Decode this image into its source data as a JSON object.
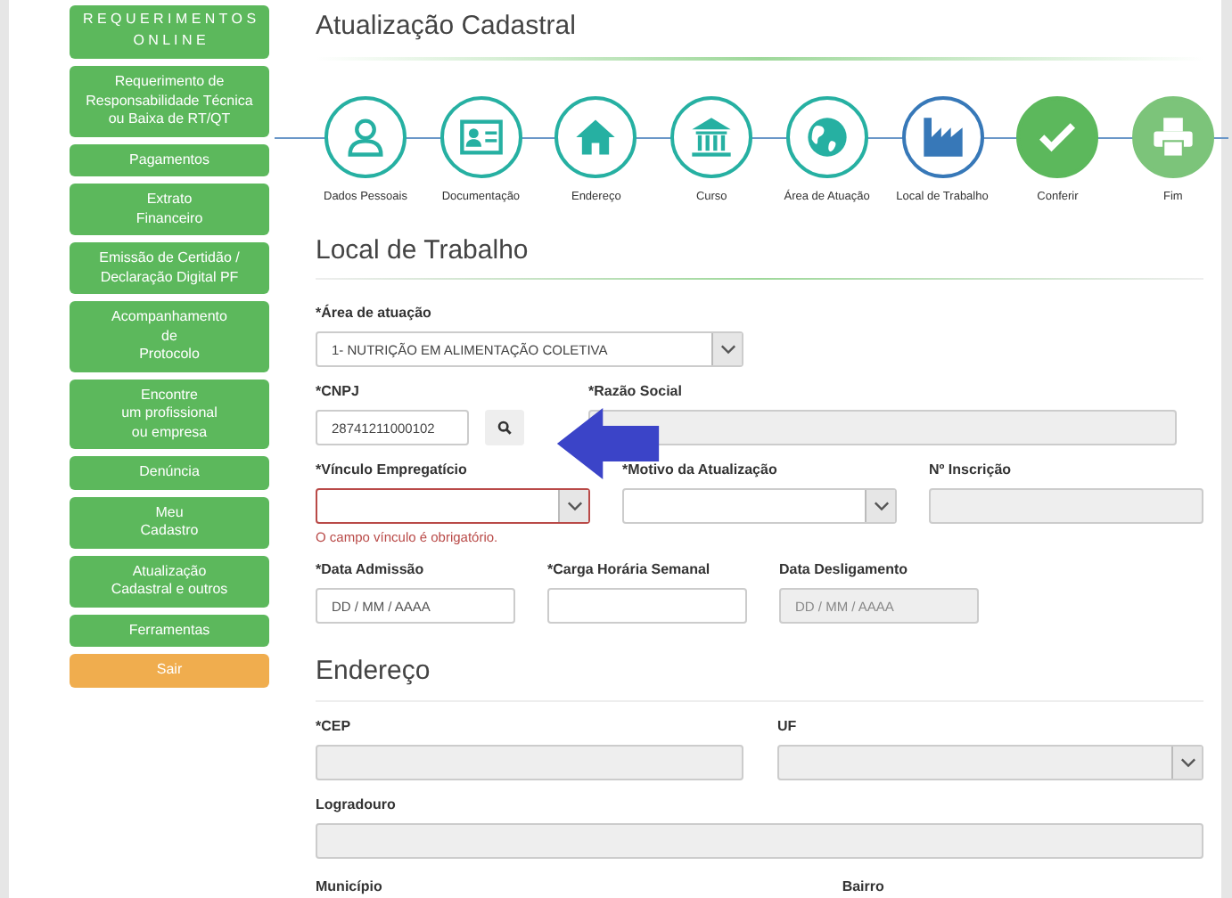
{
  "sidebar": {
    "header": "R E Q U E R I M E N T O S\nO N L I N E",
    "items": [
      {
        "label": "Requerimento de\nResponsabilidade Técnica\nou Baixa de RT/QT",
        "kind": "nav"
      },
      {
        "label": "Pagamentos",
        "kind": "nav"
      },
      {
        "label": "Extrato\nFinanceiro",
        "kind": "nav"
      },
      {
        "label": "Emissão de Certidão /\nDeclaração Digital PF",
        "kind": "nav"
      },
      {
        "label": "Acompanhamento\nde\nProtocolo",
        "kind": "nav"
      },
      {
        "label": "Encontre\num profissional\nou empresa",
        "kind": "nav"
      },
      {
        "label": "Denúncia",
        "kind": "nav"
      },
      {
        "label": "Meu\nCadastro",
        "kind": "nav"
      },
      {
        "label": "Atualização\nCadastral e outros",
        "kind": "nav"
      },
      {
        "label": "Ferramentas",
        "kind": "nav"
      },
      {
        "label": "Sair",
        "kind": "exit"
      }
    ]
  },
  "page_title": "Atualização Cadastral",
  "steps": [
    {
      "label": "Dados Pessoais",
      "completed": true,
      "selected": false
    },
    {
      "label": "Documentação",
      "completed": true,
      "selected": false
    },
    {
      "label": "Endereço",
      "completed": true,
      "selected": false
    },
    {
      "label": "Curso",
      "completed": true,
      "selected": false
    },
    {
      "label": "Área de Atuação",
      "completed": true,
      "selected": false
    },
    {
      "label": "Local de Trabalho",
      "completed": false,
      "selected": true
    },
    {
      "label": "Conferir",
      "completed": false,
      "selected": false
    },
    {
      "label": "Fim",
      "completed": false,
      "selected": false
    }
  ],
  "sections": [
    {
      "title": "Local de Trabalho",
      "rows": [
        {
          "fields": [
            {
              "label": "*Área de atuação",
              "kind": "select",
              "value": "1- NUTRIÇÃO EM ALIMENTAÇÃO COLETIVA",
              "disabled": false
            }
          ]
        },
        {
          "fields": [
            {
              "label": "*CNPJ",
              "kind": "input",
              "value": "28741211000102",
              "disabled": false
            },
            {
              "kind": "search"
            },
            {
              "label": "*Razão Social",
              "kind": "input",
              "disabled": true
            }
          ]
        },
        {
          "fields": [
            {
              "label": "*Vínculo Empregatício",
              "kind": "select",
              "disabled": false,
              "error": "O campo vínculo é obrigatório."
            },
            {
              "label": "*Motivo da Atualização",
              "kind": "select",
              "disabled": false
            },
            {
              "label": "Nº Inscrição",
              "kind": "input",
              "disabled": true
            }
          ]
        },
        {
          "fields": [
            {
              "label": "*Data Admissão",
              "kind": "input",
              "placeholder": "DD / MM / AAAA",
              "disabled": false
            },
            {
              "label": "*Carga Horária Semanal",
              "kind": "input",
              "disabled": false
            },
            {
              "label": "Data Desligamento",
              "kind": "input",
              "placeholder": "DD / MM / AAAA",
              "disabled": true
            }
          ]
        }
      ]
    },
    {
      "title": "Endereço",
      "rows": [
        {
          "fields": [
            {
              "label": "*CEP",
              "kind": "input",
              "disabled": true
            },
            {
              "label": "UF",
              "kind": "select",
              "disabled": true
            }
          ]
        },
        {
          "fields": [
            {
              "label": "Logradouro",
              "kind": "input",
              "disabled": true
            }
          ]
        },
        {
          "fields": [
            {
              "label": "Município",
              "kind": "label"
            },
            {
              "label": "Bairro",
              "kind": "label"
            }
          ]
        }
      ]
    }
  ]
}
